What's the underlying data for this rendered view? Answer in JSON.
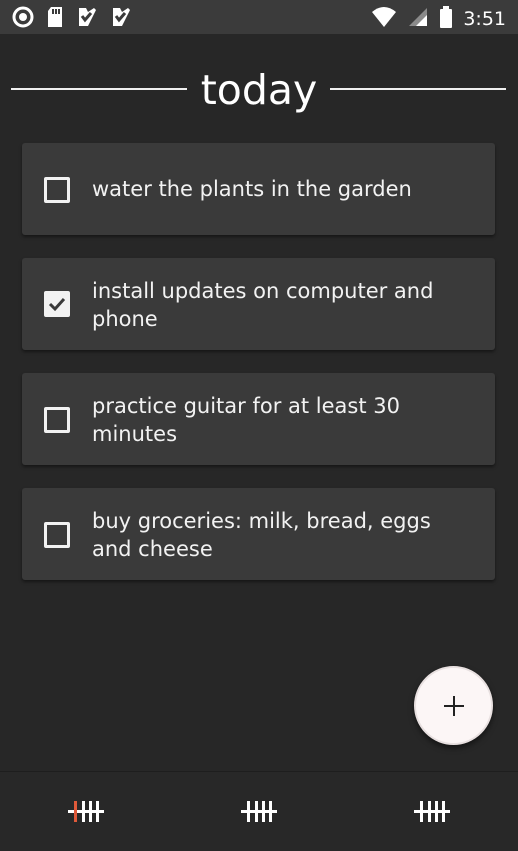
{
  "status_bar": {
    "time": "3:51",
    "left_icons": [
      "circle-notification-icon",
      "sd-card-icon",
      "app-check-icon",
      "app-check-icon"
    ],
    "right_icons": [
      "wifi-icon",
      "signal-icon",
      "battery-icon"
    ]
  },
  "header": {
    "title": "today"
  },
  "tasks": [
    {
      "text": "water the plants in the garden",
      "checked": false
    },
    {
      "text": "install updates on computer and phone",
      "checked": true
    },
    {
      "text": "practice guitar for at least 30 minutes",
      "checked": false
    },
    {
      "text": "buy groceries: milk, bread, eggs and cheese",
      "checked": false
    }
  ],
  "fab": {
    "icon": "plus-icon"
  },
  "bottom_nav": {
    "items": [
      {
        "icon": "tally-icon",
        "active": true
      },
      {
        "icon": "tally-icon",
        "active": false
      },
      {
        "icon": "tally-icon",
        "active": false
      }
    ]
  },
  "colors": {
    "background": "#272727",
    "card": "#3a3a3a",
    "status_bar": "#3b3b3b",
    "accent": "#e05a3a",
    "text": "#f2f2f2"
  }
}
